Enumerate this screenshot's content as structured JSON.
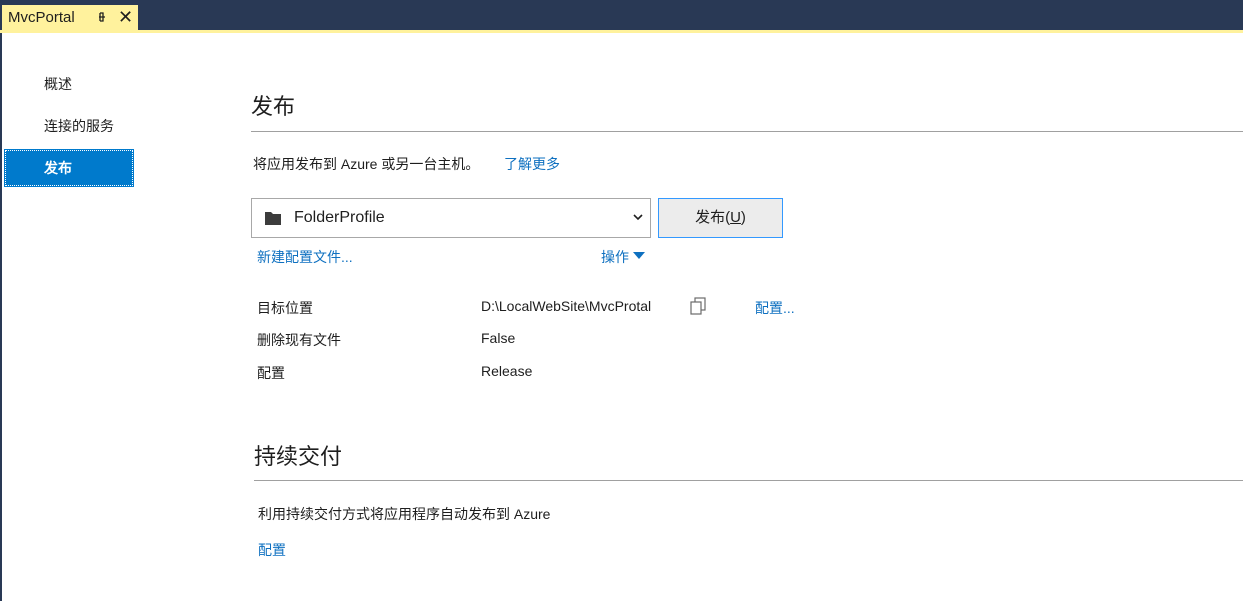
{
  "document_tab": {
    "title": "MvcPortal",
    "pin_icon": "pin-icon",
    "close_icon": "close-icon",
    "close_glyph": "✕"
  },
  "nav": {
    "items": [
      {
        "label": "概述",
        "selected": false
      },
      {
        "label": "连接的服务",
        "selected": false
      },
      {
        "label": "发布",
        "selected": true
      }
    ]
  },
  "publish": {
    "heading": "发布",
    "description": "将应用发布到 Azure 或另一台主机。",
    "learn_more": "了解更多",
    "profile": {
      "selected": "FolderProfile",
      "icon": "folder-icon"
    },
    "button_prefix": "发布(",
    "button_accel": "U",
    "button_suffix": ")",
    "new_profile_link": "新建配置文件...",
    "actions_link": "操作",
    "properties": [
      {
        "label": "目标位置",
        "value": "D:\\LocalWebSite\\MvcProtal"
      },
      {
        "label": "删除现有文件",
        "value": "False"
      },
      {
        "label": "配置",
        "value": "Release"
      }
    ],
    "configure_link": "配置..."
  },
  "cd": {
    "heading": "持续交付",
    "description": "利用持续交付方式将应用程序自动发布到 Azure",
    "configure_link": "配置"
  },
  "colors": {
    "tab_bg": "#fff29d",
    "chrome": "#293955",
    "accent": "#007acc",
    "link": "#0e70c0"
  }
}
